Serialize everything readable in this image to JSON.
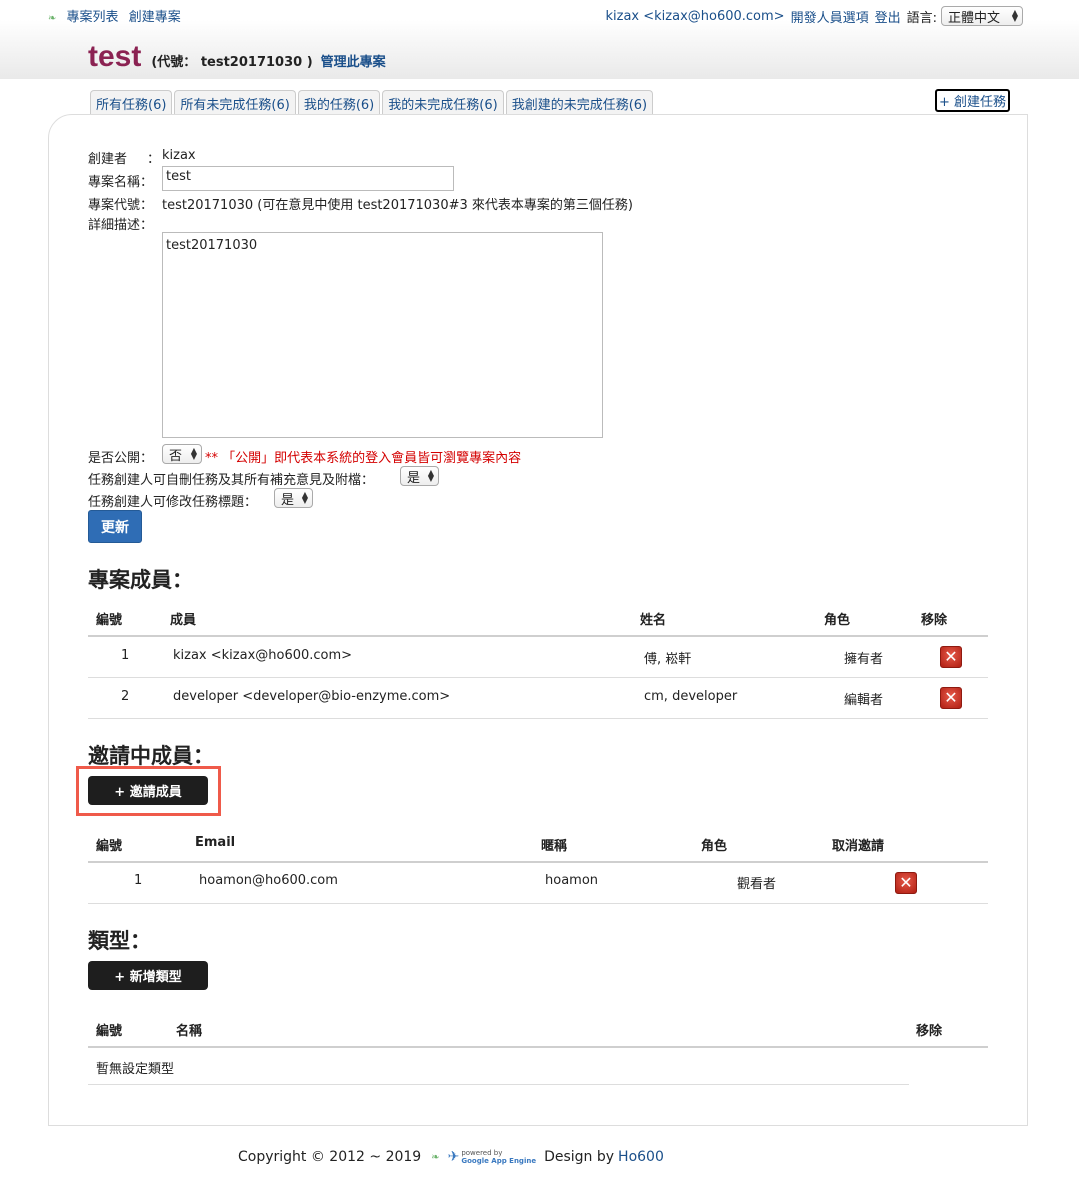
{
  "nav": {
    "project_list": "專案列表",
    "create_project": "創建專案",
    "user": "kizax <kizax@ho600.com>",
    "dev_options": "開發人員選項",
    "logout": "登出",
    "language_label": "語言:",
    "language_value": "正體中文"
  },
  "project": {
    "name": "test",
    "code_label": "(代號：  test20171030 )",
    "manage_label": "管理此專案"
  },
  "tabs": [
    {
      "label": "所有任務(6)"
    },
    {
      "label": "所有未完成任務(6)"
    },
    {
      "label": "我的任務(6)"
    },
    {
      "label": "我的未完成任務(6)"
    },
    {
      "label": "我創建的未完成任務(6)"
    }
  ],
  "create_task_label": "+ 創建任務",
  "form": {
    "creator_label": "創建者",
    "creator_sep": "：",
    "creator_value": "kizax",
    "name_label": "專案名稱：",
    "name_value": "test",
    "code_label": "專案代號：",
    "code_value": "test20171030 (可在意見中使用 test20171030#3 來代表本專案的第三個任務)",
    "desc_label": "詳細描述：",
    "desc_value": "test20171030",
    "public_label": "是否公開：",
    "public_value": "否",
    "public_note": "** 「公開」即代表本系統的登入會員皆可瀏覽專案內容",
    "delete_label": "任務創建人可自刪任務及其所有補充意見及附檔：",
    "delete_value": "是",
    "edit_label": "任務創建人可修改任務標題：",
    "edit_value": "是",
    "update_button": "更新"
  },
  "members": {
    "title": "專案成員：",
    "headers": {
      "no": "編號",
      "member": "成員",
      "name": "姓名",
      "role": "角色",
      "remove": "移除"
    },
    "rows": [
      {
        "no": "1",
        "member": "kizax <kizax@ho600.com>",
        "name": "傅, 崧軒",
        "role": "擁有者"
      },
      {
        "no": "2",
        "member": "developer <developer@bio-enzyme.com>",
        "name": "cm, developer",
        "role": "編輯者"
      }
    ]
  },
  "invited": {
    "title": "邀請中成員：",
    "invite_button": "+ 邀請成員",
    "headers": {
      "no": "編號",
      "email": "Email",
      "nickname": "暱稱",
      "role": "角色",
      "cancel": "取消邀請"
    },
    "rows": [
      {
        "no": "1",
        "email": "hoamon@ho600.com",
        "nickname": "hoamon",
        "role": "觀看者"
      }
    ]
  },
  "types": {
    "title": "類型：",
    "add_button": "+ 新增類型",
    "headers": {
      "no": "編號",
      "name": "名稱",
      "remove": "移除"
    },
    "empty": "暫無設定類型"
  },
  "footer": {
    "copyright": "Copyright © 2012 ~ 2019",
    "gae_powered": "powered by",
    "gae_name": "Google App Engine",
    "design_by": "Design by",
    "designer": "Ho600"
  },
  "colors": {
    "brand_title": "#8b2252",
    "link": "#1a4f8a",
    "primary_button": "#2f6db5",
    "dark_button": "#1e1e1e",
    "note": "#d40000",
    "highlight": "#ef5a4a"
  }
}
